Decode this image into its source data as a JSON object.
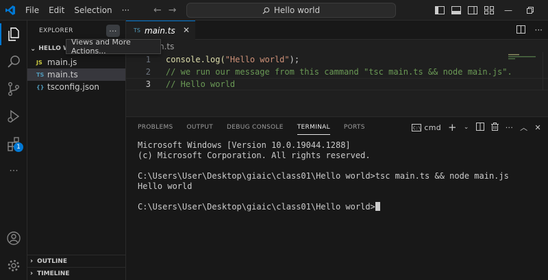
{
  "menu": [
    "File",
    "Edit",
    "Selection",
    "···"
  ],
  "command_center": {
    "text": "Hello world"
  },
  "sidebar": {
    "header": "EXPLORER",
    "more_label": "···",
    "folder": "HELLO W",
    "files": [
      {
        "icon": "JS",
        "name": "main.js",
        "selected": false
      },
      {
        "icon": "TS",
        "name": "main.ts",
        "selected": true
      },
      {
        "icon": "{}",
        "name": "tsconfig.json",
        "selected": false
      }
    ],
    "outline": "OUTLINE",
    "timeline": "TIMELINE",
    "tooltip": "Views and More Actions..."
  },
  "activity": {
    "extensions_badge": "1"
  },
  "editor": {
    "tab": {
      "icon": "TS",
      "label": "main.ts"
    },
    "breadcrumb": "n.ts",
    "lines": [
      {
        "num": "1",
        "fn": "console.log(",
        "str": "\"Hello world\"",
        "rest": ");"
      },
      {
        "num": "2",
        "comment": "// we run our message from this cammand \"tsc main.ts && node main.js\"."
      },
      {
        "num": "3",
        "comment": "// Hello world"
      }
    ]
  },
  "panel": {
    "tabs": [
      "PROBLEMS",
      "OUTPUT",
      "DEBUG CONSOLE",
      "TERMINAL",
      "PORTS"
    ],
    "active_tab": "TERMINAL",
    "terminal_label": "cmd",
    "terminal_lines": [
      "Microsoft Windows [Version 10.0.19044.1288]",
      "(c) Microsoft Corporation. All rights reserved.",
      "",
      "C:\\Users\\User\\Desktop\\giaic\\class01\\Hello world>tsc main.ts && node main.js",
      "Hello world",
      "",
      "C:\\Users\\User\\Desktop\\giaic\\class01\\Hello world>"
    ]
  },
  "colors": {
    "accent": "#0078d4",
    "function": "#dcdcaa",
    "string": "#ce9178",
    "comment": "#6a9955"
  }
}
